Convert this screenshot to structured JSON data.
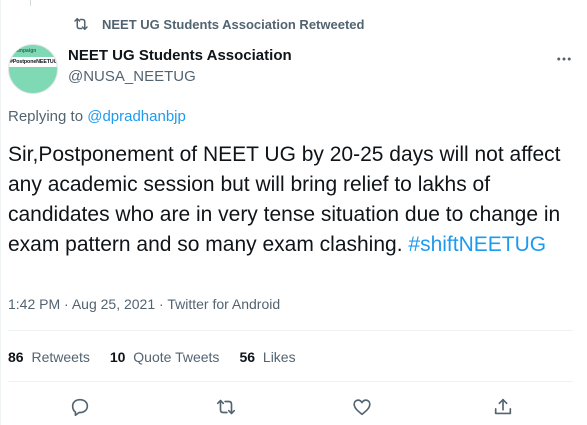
{
  "retweet_context": {
    "label": "NEET UG Students Association Retweeted",
    "icon": "retweet-icon"
  },
  "avatar": {
    "line1": "campaign",
    "line2": "#PostponeNEETUG",
    "color": "#7fd9b5"
  },
  "author": {
    "name": "NEET UG Students Association",
    "handle": "@NUSA_NEETUG"
  },
  "replying_to": {
    "prefix": "Replying to",
    "mention": "@dpradhanbjp"
  },
  "tweet": {
    "text": "Sir,Postponement of NEET UG by 20-25 days will not affect any academic session but will bring relief to lakhs of candidates who are in very tense situation due to change in exam pattern and so many exam clashing.",
    "hashtag": "#shiftNEETUG"
  },
  "meta": {
    "time": "1:42 PM",
    "date": "Aug 25, 2021",
    "source": "Twitter for Android",
    "separator": "·"
  },
  "stats": {
    "retweets": {
      "count": "86",
      "label": "Retweets"
    },
    "quotes": {
      "count": "10",
      "label": "Quote Tweets"
    },
    "likes": {
      "count": "56",
      "label": "Likes"
    }
  },
  "actions": [
    "reply-icon",
    "retweet-icon",
    "like-icon",
    "share-icon"
  ],
  "colors": {
    "accent": "#1d9bf0",
    "secondary_text": "#536471",
    "primary_text": "#0f1419"
  }
}
